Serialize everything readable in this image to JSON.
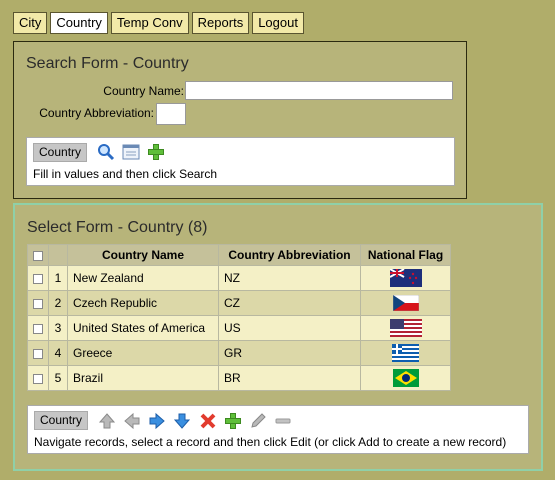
{
  "nav": {
    "tabs": [
      "City",
      "Country",
      "Temp Conv",
      "Reports",
      "Logout"
    ]
  },
  "search": {
    "title": "Search Form - Country",
    "name_label": "Country Name:",
    "name_value": "",
    "abbr_label": "Country Abbreviation:",
    "abbr_value": "",
    "chip": "Country",
    "hint": "Fill in values and then click Search",
    "icons": [
      "search-icon",
      "clear-form-icon",
      "add-icon"
    ]
  },
  "select": {
    "title": "Select Form - Country (8)",
    "columns": [
      "Country Name",
      "Country Abbreviation",
      "National Flag"
    ],
    "rows": [
      {
        "num": "1",
        "name": "New Zealand",
        "abbr": "NZ",
        "flag": "nz-flag-icon"
      },
      {
        "num": "2",
        "name": "Czech Republic",
        "abbr": "CZ",
        "flag": "cz-flag-icon"
      },
      {
        "num": "3",
        "name": "United States of America",
        "abbr": "US",
        "flag": "us-flag-icon"
      },
      {
        "num": "4",
        "name": "Greece",
        "abbr": "GR",
        "flag": "gr-flag-icon"
      },
      {
        "num": "5",
        "name": "Brazil",
        "abbr": "BR",
        "flag": "br-flag-icon"
      }
    ],
    "chip": "Country",
    "hint": "Navigate records, select a record and then click Edit (or click Add to create a new record)",
    "icons": [
      "first-record-icon",
      "previous-record-icon",
      "next-record-icon",
      "last-record-icon",
      "delete-icon",
      "add-icon",
      "edit-icon",
      "remove-icon"
    ]
  },
  "colors": {
    "background": "#b0ad6a",
    "tab": "#f2e9a8",
    "row_light": "#f4f0c6",
    "row_dark": "#dcd8a8",
    "header": "#c5c19a"
  }
}
